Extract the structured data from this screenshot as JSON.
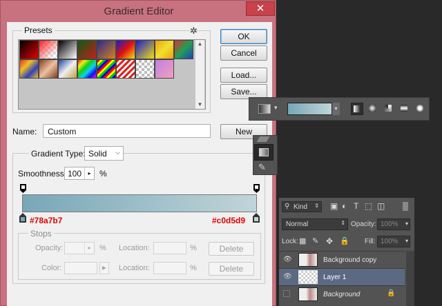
{
  "window": {
    "title": "Gradient Editor",
    "close_glyph": "✕"
  },
  "presets": {
    "label": "Presets",
    "menu_icon": "gear-icon",
    "menu_glyph": "✲"
  },
  "buttons": {
    "ok": "OK",
    "cancel": "Cancel",
    "load": "Load...",
    "save": "Save...",
    "new": "New"
  },
  "name": {
    "label": "Name:",
    "value": "Custom"
  },
  "gradient_type": {
    "label": "Gradient Type:",
    "value": "Solid"
  },
  "smoothness": {
    "label": "Smoothness:",
    "value": "100",
    "unit": "%"
  },
  "gradient": {
    "start_color": "#78a7b7",
    "end_color": "#c0d5d9",
    "start_label": "#78a7b7",
    "end_label": "#c0d5d9"
  },
  "stops": {
    "label": "Stops",
    "opacity_label": "Opacity:",
    "opacity_unit": "%",
    "color_label": "Color:",
    "location_label": "Location:",
    "location_unit": "%",
    "delete_label": "Delete"
  },
  "ps": {
    "kind_label": "Kind",
    "blend_mode": "Normal",
    "opacity_label": "Opacity:",
    "opacity_value": "100%",
    "lock_label": "Lock:",
    "fill_label": "Fill:",
    "fill_value": "100%",
    "layers": [
      {
        "name": "Background copy",
        "selected": false,
        "italic": false
      },
      {
        "name": "Layer 1",
        "selected": true,
        "italic": false
      },
      {
        "name": "Background",
        "selected": false,
        "italic": true
      }
    ]
  },
  "colors": {
    "accent_red": "#e00000",
    "selection": "#5b6a82"
  }
}
